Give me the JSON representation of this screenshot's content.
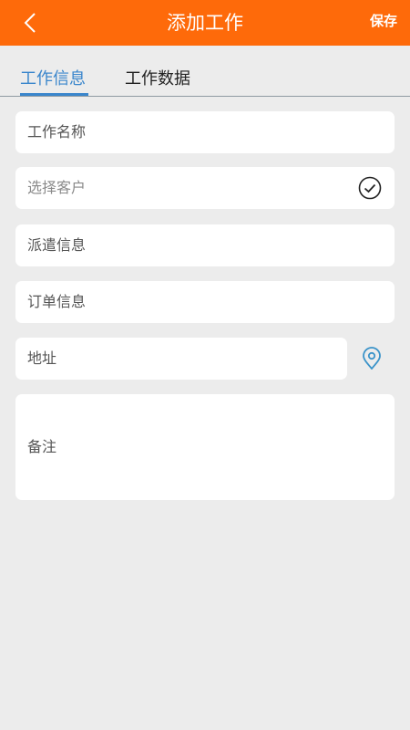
{
  "header": {
    "title": "添加工作",
    "save_label": "保存",
    "back_icon": "chevron-left-icon"
  },
  "tabs": [
    {
      "label": "工作信息",
      "active": true
    },
    {
      "label": "工作数据",
      "active": false
    }
  ],
  "form": {
    "job_name": {
      "label": "工作名称"
    },
    "customer": {
      "placeholder": "选择客户",
      "icon": "check-circle-icon"
    },
    "dispatch": {
      "label": "派遣信息"
    },
    "order": {
      "label": "订单信息"
    },
    "address": {
      "label": "地址",
      "icon": "location-pin-icon"
    },
    "notes": {
      "label": "备注"
    }
  },
  "colors": {
    "header_bg": "#fe6a0a",
    "accent": "#3a86cc",
    "page_bg": "#ececec",
    "field_bg": "#ffffff"
  }
}
